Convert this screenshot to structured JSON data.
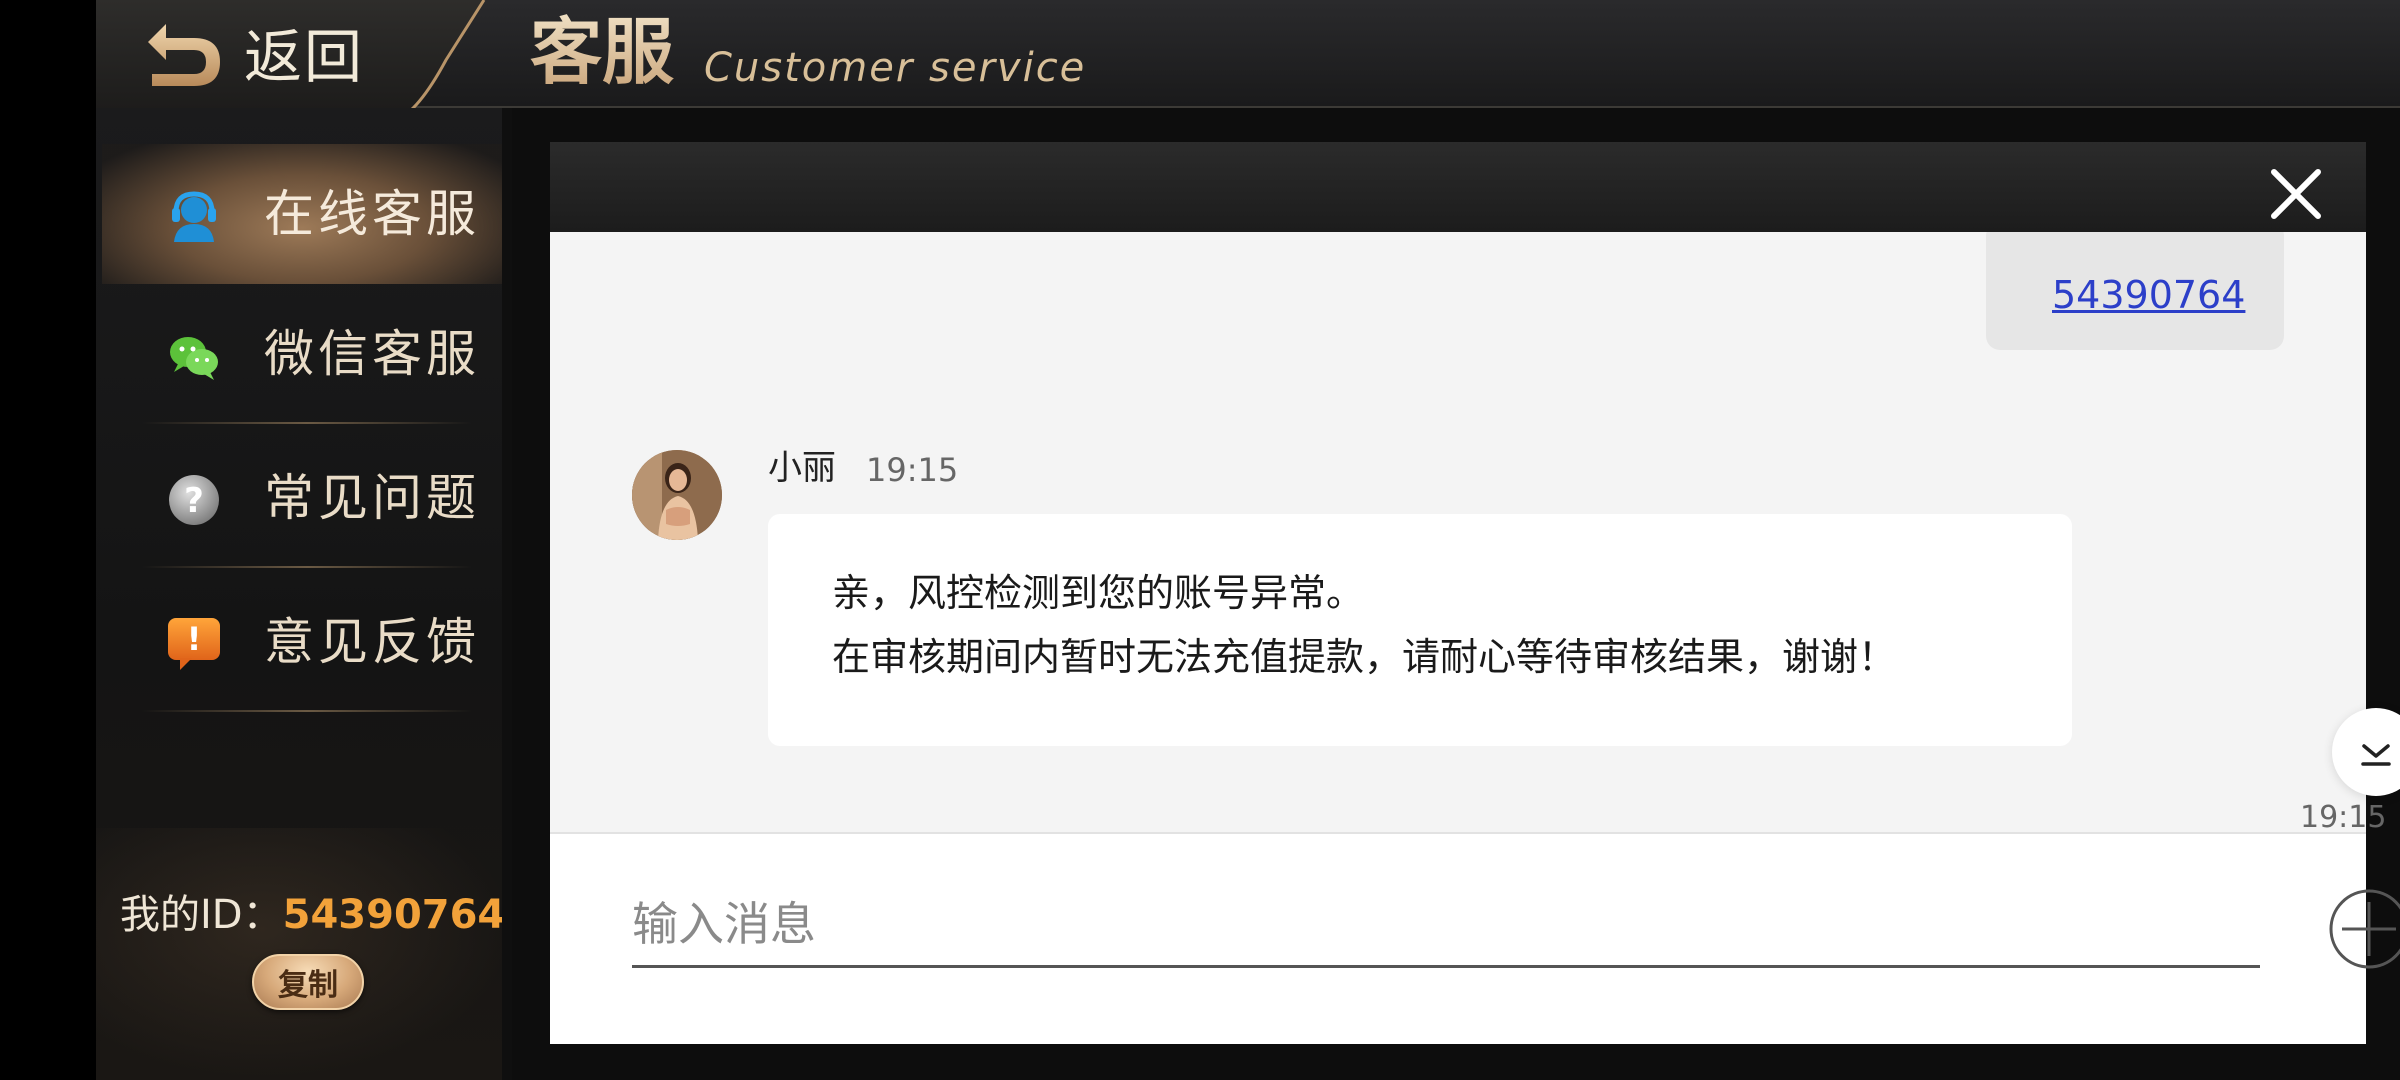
{
  "header": {
    "back_label": "返回",
    "title": "客服",
    "subtitle": "Customer service"
  },
  "sidebar": {
    "items": [
      {
        "label": "在线客服",
        "icon": "headset-icon",
        "active": true
      },
      {
        "label": "微信客服",
        "icon": "wechat-icon",
        "active": false
      },
      {
        "label": "常见问题",
        "icon": "question-icon",
        "active": false
      },
      {
        "label": "意见反馈",
        "icon": "feedback-icon",
        "active": false
      }
    ],
    "my_id_label": "我的ID：",
    "my_id_value": "54390764",
    "copy_label": "复制"
  },
  "chat": {
    "user_message": "54390764",
    "agent": {
      "name": "小丽",
      "time": "19:15",
      "lines": [
        "亲，风控检测到您的账号异常。",
        "在审核期间内暂时无法充值提款，请耐心等待审核结果，谢谢！"
      ]
    },
    "bottom_time": "19:15",
    "input_placeholder": "输入消息"
  },
  "colors": {
    "accent_gold": "#e2c9a2",
    "id_orange": "#f2a23a",
    "link_blue": "#2c3fc9"
  }
}
